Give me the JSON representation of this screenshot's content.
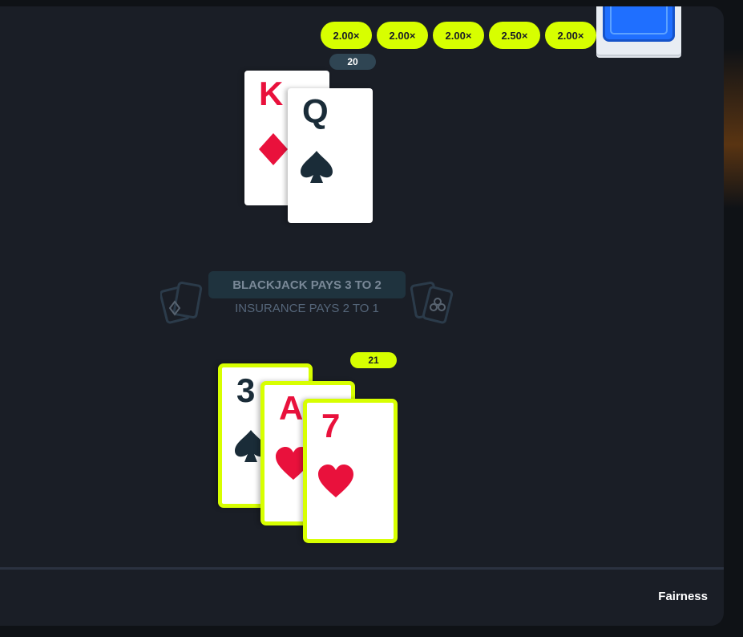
{
  "history": [
    "2.00×",
    "2.00×",
    "2.00×",
    "2.50×",
    "2.00×"
  ],
  "dealer": {
    "score": "20",
    "cards": [
      {
        "rank": "K",
        "suit": "diamond"
      },
      {
        "rank": "Q",
        "suit": "spade"
      }
    ]
  },
  "info": {
    "blackjack": "BLACKJACK PAYS 3 TO 2",
    "insurance": "INSURANCE PAYS 2 TO 1"
  },
  "player": {
    "score": "21",
    "cards": [
      {
        "rank": "3",
        "suit": "spade"
      },
      {
        "rank": "A",
        "suit": "heart"
      },
      {
        "rank": "7",
        "suit": "heart"
      }
    ]
  },
  "footer": {
    "fairness": "Fairness"
  },
  "colors": {
    "accent": "#d7ff00",
    "red": "#e9113c",
    "dark": "#1a2c38",
    "panel": "#1a1e26"
  },
  "icons": {
    "shoe": "card-shoe-icon",
    "deco_left": "diamond-card-icon",
    "deco_right": "club-card-icon"
  }
}
